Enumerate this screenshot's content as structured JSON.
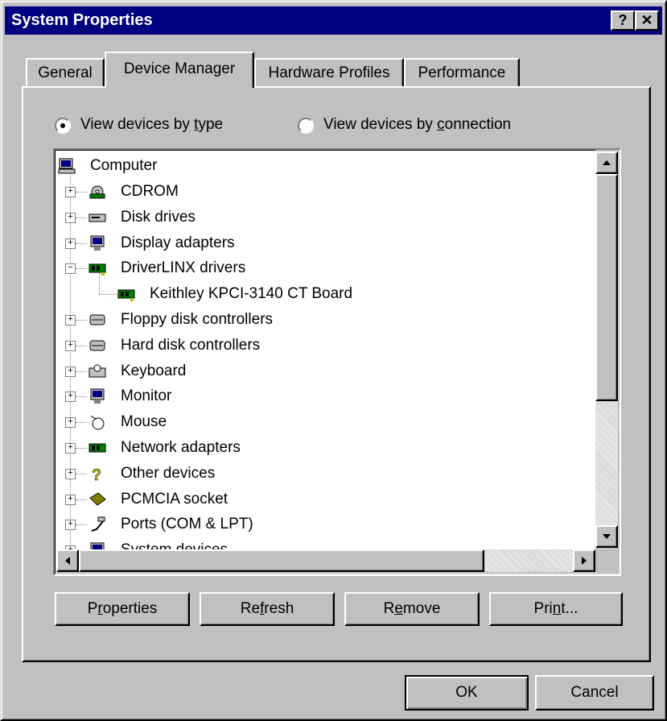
{
  "window": {
    "title": "System Properties",
    "help_label": "?",
    "close_label": "✕"
  },
  "tabs": [
    {
      "label": "General"
    },
    {
      "label": "Device Manager"
    },
    {
      "label": "Hardware Profiles"
    },
    {
      "label": "Performance"
    }
  ],
  "view_options": {
    "by_type": {
      "pre": "View devices by ",
      "accel": "t",
      "post": "ype",
      "selected": true
    },
    "by_connection": {
      "pre": "View devices by ",
      "accel": "c",
      "post": "onnection",
      "selected": false
    }
  },
  "tree": {
    "root": {
      "label": "Computer",
      "icon": "computer-icon"
    },
    "items": [
      {
        "label": "CDROM",
        "icon": "cdrom-icon",
        "expander": "+"
      },
      {
        "label": "Disk drives",
        "icon": "disk-drive-icon",
        "expander": "+"
      },
      {
        "label": "Display adapters",
        "icon": "display-adapter-icon",
        "expander": "+"
      },
      {
        "label": "DriverLINX drivers",
        "icon": "driverlinx-board-icon",
        "expander": "−"
      },
      {
        "label": "Keithley KPCI-3140 CT Board",
        "icon": "board-icon",
        "child": true
      },
      {
        "label": "Floppy disk controllers",
        "icon": "floppy-controller-icon",
        "expander": "+"
      },
      {
        "label": "Hard disk controllers",
        "icon": "hard-disk-controller-icon",
        "expander": "+"
      },
      {
        "label": "Keyboard",
        "icon": "keyboard-icon",
        "expander": "+"
      },
      {
        "label": "Monitor",
        "icon": "monitor-icon",
        "expander": "+"
      },
      {
        "label": "Mouse",
        "icon": "mouse-icon",
        "expander": "+"
      },
      {
        "label": "Network adapters",
        "icon": "network-adapter-icon",
        "expander": "+"
      },
      {
        "label": "Other devices",
        "icon": "question-icon",
        "expander": "+"
      },
      {
        "label": "PCMCIA socket",
        "icon": "pcmcia-icon",
        "expander": "+"
      },
      {
        "label": "Ports (COM & LPT)",
        "icon": "port-icon",
        "expander": "+"
      },
      {
        "label": "System devices",
        "icon": "system-devices-icon",
        "expander": "+"
      }
    ]
  },
  "buttons": {
    "properties": {
      "pre": "P",
      "accel": "r",
      "post": "operties"
    },
    "refresh": {
      "pre": "Re",
      "accel": "f",
      "post": "resh"
    },
    "remove": {
      "pre": "R",
      "accel": "e",
      "post": "move"
    },
    "print": {
      "pre": "Pri",
      "accel": "n",
      "post": "t..."
    },
    "ok": "OK",
    "cancel": "Cancel"
  }
}
